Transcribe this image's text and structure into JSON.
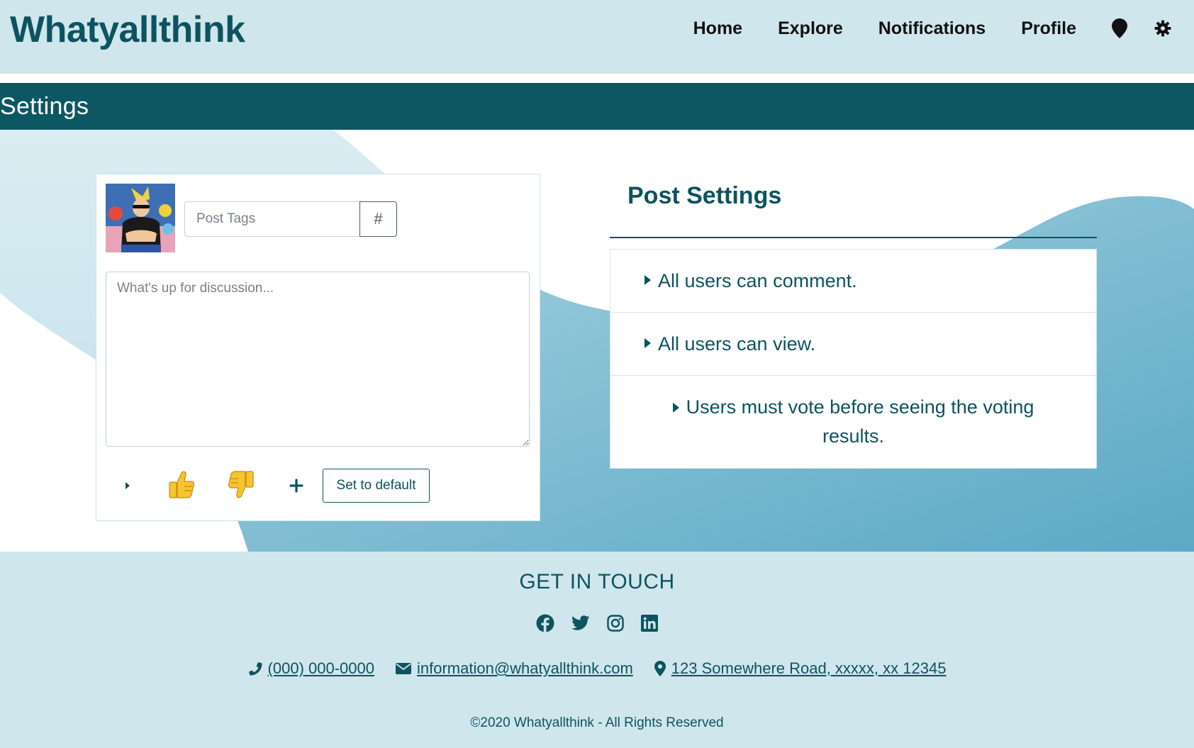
{
  "header": {
    "brand": "Whatyallthink",
    "nav": [
      "Home",
      "Explore",
      "Notifications",
      "Profile"
    ],
    "icons": [
      "map-marker-icon",
      "gear-icon"
    ]
  },
  "page": {
    "title": "Settings"
  },
  "composer": {
    "tags_placeholder": "Post Tags",
    "hash_label": "#",
    "discussion_placeholder": "What's up for discussion...",
    "toolbar": {
      "icons": [
        "caret-right-icon",
        "thumbs-up-icon",
        "thumbs-down-icon",
        "plus-icon"
      ],
      "default_label": "Set to default"
    }
  },
  "post_settings": {
    "title": "Post Settings",
    "items": [
      "All users can comment.",
      "All users can view.",
      "Users must vote before seeing the voting results."
    ]
  },
  "footer": {
    "title": "GET IN TOUCH",
    "socials": [
      "facebook-icon",
      "twitter-icon",
      "instagram-icon",
      "linkedin-icon"
    ],
    "phone": " (000) 000-0000",
    "email": " information@whatyallthink.com",
    "address": " 123 Somewhere Road, xxxxx, xx 12345",
    "copyright": "©2020 Whatyallthink - All Rights Reserved"
  },
  "colors": {
    "brand": "#0d5360",
    "header_bg": "#d0e6ed",
    "titlebar_bg": "#0d5763",
    "wave_light": "#d8ecf1",
    "wave_dark": "#5aaac6"
  }
}
